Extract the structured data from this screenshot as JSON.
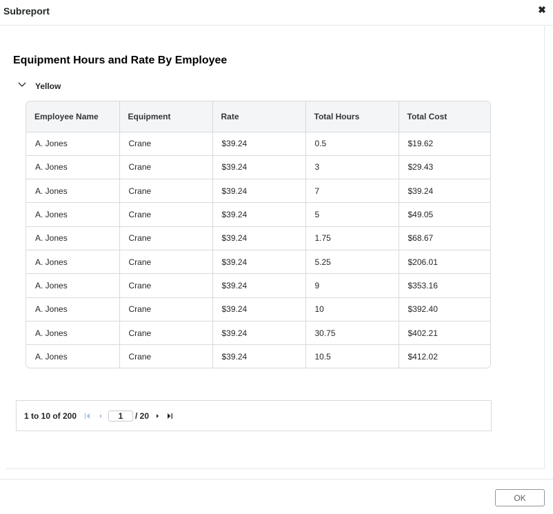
{
  "dialog": {
    "title": "Subreport",
    "close_glyph": "✖",
    "close_icon": "close-icon"
  },
  "report": {
    "title": "Equipment Hours and Rate By Employee",
    "group": {
      "label": "Yellow",
      "icon": "chevron-down-icon",
      "expanded": true
    }
  },
  "table": {
    "columns": [
      "Employee Name",
      "Equipment",
      "Rate",
      "Total Hours",
      "Total Cost"
    ],
    "rows": [
      [
        "A. Jones",
        "Crane",
        "$39.24",
        "0.5",
        "$19.62"
      ],
      [
        "A. Jones",
        "Crane",
        "$39.24",
        "3",
        "$29.43"
      ],
      [
        "A. Jones",
        "Crane",
        "$39.24",
        "7",
        "$39.24"
      ],
      [
        "A. Jones",
        "Crane",
        "$39.24",
        "5",
        "$49.05"
      ],
      [
        "A. Jones",
        "Crane",
        "$39.24",
        "1.75",
        "$68.67"
      ],
      [
        "A. Jones",
        "Crane",
        "$39.24",
        "5.25",
        "$206.01"
      ],
      [
        "A. Jones",
        "Crane",
        "$39.24",
        "9",
        "$353.16"
      ],
      [
        "A. Jones",
        "Crane",
        "$39.24",
        "10",
        "$392.40"
      ],
      [
        "A. Jones",
        "Crane",
        "$39.24",
        "30.75",
        "$402.21"
      ],
      [
        "A. Jones",
        "Crane",
        "$39.24",
        "10.5",
        "$412.02"
      ]
    ]
  },
  "pager": {
    "summary": "1 to 10 of 200",
    "current_page": "1",
    "total_pages": "/ 20",
    "icons": [
      "first-page-icon",
      "previous-page-icon",
      "next-page-icon",
      "last-page-icon"
    ]
  },
  "footer": {
    "ok_label": "OK"
  },
  "colors": {
    "border": "#d6dadc",
    "header_bg": "#f4f5f6",
    "text": "#232628",
    "disabled_icon": "#a8c4e0",
    "active_icon": "#232628"
  }
}
